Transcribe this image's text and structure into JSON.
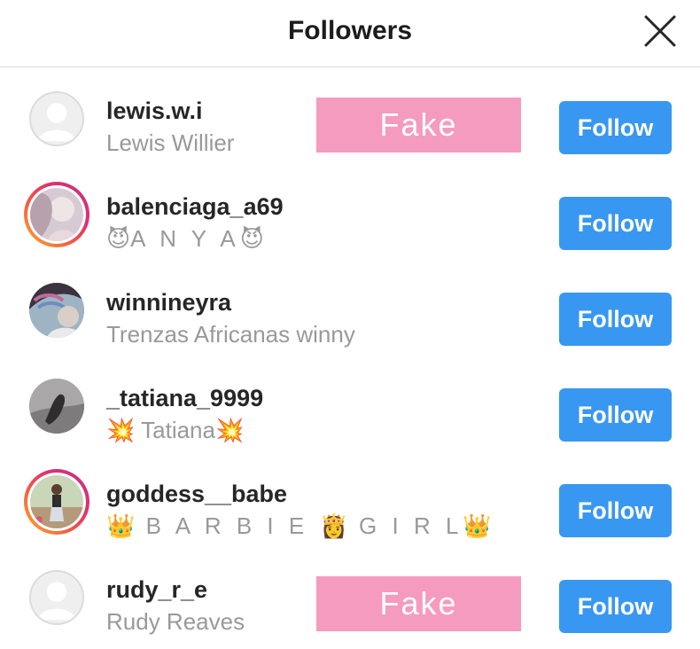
{
  "header": {
    "title": "Followers"
  },
  "follow_label": "Follow",
  "fake_label": "Fake",
  "accent_color": "#3897f0",
  "fake_color": "#f59bc0",
  "followers": [
    {
      "username": "lewis.w.i",
      "full_name": "Lewis Willier",
      "avatar": "default-avatar-icon",
      "story_ring": false,
      "fake_tag": true
    },
    {
      "username": "balenciaga_a69",
      "full_name_parts": [
        "😈",
        "A N Y A",
        "😈"
      ],
      "avatar": "profile-photo",
      "story_ring": true,
      "fake_tag": false
    },
    {
      "username": "winnineyra",
      "full_name": "Trenzas Africanas winny",
      "avatar": "profile-photo",
      "story_ring": false,
      "fake_tag": false
    },
    {
      "username": "_tatiana_9999",
      "full_name_parts": [
        "💥",
        " Tatiana",
        "💥"
      ],
      "avatar": "profile-photo",
      "story_ring": false,
      "fake_tag": false
    },
    {
      "username": "goddess__babe",
      "full_name_parts": [
        "👑",
        " B A R B I E ",
        "👸",
        " G I R L",
        "👑"
      ],
      "avatar": "profile-photo",
      "story_ring": true,
      "fake_tag": false
    },
    {
      "username": "rudy_r_e",
      "full_name": "Rudy Reaves",
      "avatar": "default-avatar-icon",
      "story_ring": false,
      "fake_tag": true
    }
  ]
}
